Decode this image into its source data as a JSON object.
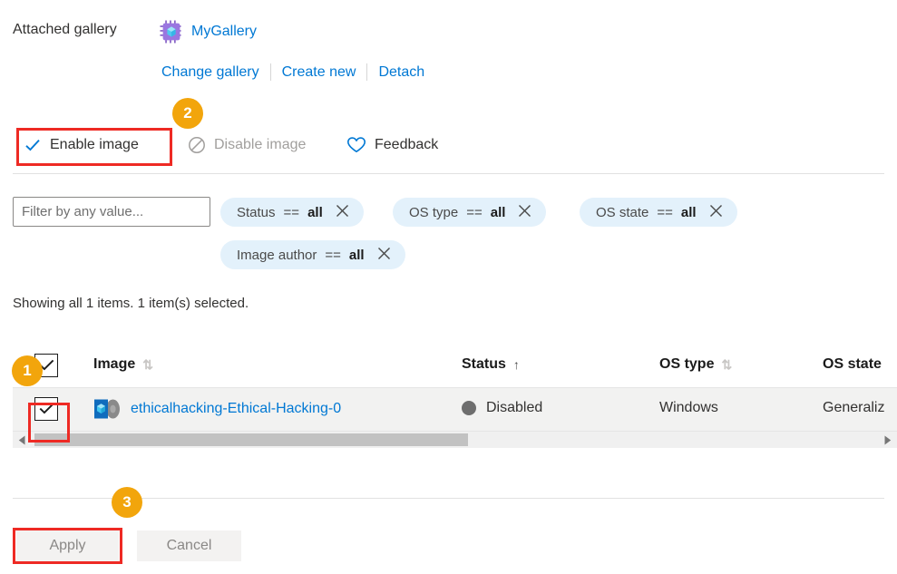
{
  "attached_gallery": {
    "label": "Attached gallery",
    "gallery_name": "MyGallery",
    "gallery_icon": "gallery-chip-icon",
    "actions": [
      {
        "label": "Change gallery"
      },
      {
        "label": "Create new"
      },
      {
        "label": "Detach"
      }
    ]
  },
  "command_bar": {
    "enable": {
      "label": "Enable image",
      "icon": "checkmark-icon",
      "enabled": true
    },
    "disable": {
      "label": "Disable image",
      "icon": "block-circle-icon",
      "enabled": false
    },
    "feedback": {
      "label": "Feedback",
      "icon": "heart-icon",
      "enabled": true
    }
  },
  "filters": {
    "search_placeholder": "Filter by any value...",
    "search_value": "",
    "pills": [
      {
        "field": "Status",
        "op": "==",
        "value": "all",
        "remove_icon": "close-icon"
      },
      {
        "field": "OS type",
        "op": "==",
        "value": "all",
        "remove_icon": "close-icon"
      },
      {
        "field": "OS state",
        "op": "==",
        "value": "all",
        "remove_icon": "close-icon"
      },
      {
        "field": "Image author",
        "op": "==",
        "value": "all",
        "remove_icon": "close-icon"
      }
    ]
  },
  "status_line": "Showing all 1 items.  1 item(s) selected.",
  "table": {
    "select_all_checked": true,
    "columns": [
      {
        "key": "image",
        "label": "Image",
        "sort": "both"
      },
      {
        "key": "status",
        "label": "Status",
        "sort": "asc"
      },
      {
        "key": "ostype",
        "label": "OS type",
        "sort": "both"
      },
      {
        "key": "osstate",
        "label": "OS state",
        "sort": "none"
      }
    ],
    "sort_glyphs": {
      "both": "⇅",
      "asc": "↑"
    },
    "rows": [
      {
        "selected": true,
        "icon": "vm-image-icon",
        "name": "ethicalhacking-Ethical-Hacking-0",
        "status": "Disabled",
        "status_dot_color": "#6e6e6e",
        "ostype": "Windows",
        "osstate": "Generaliz"
      }
    ]
  },
  "scrollbar": {
    "left_arrow_icon": "caret-left-icon",
    "right_arrow_icon": "caret-right-icon"
  },
  "footer": {
    "apply_label": "Apply",
    "cancel_label": "Cancel"
  },
  "annotations": {
    "badges": [
      {
        "id": "1",
        "text": "1"
      },
      {
        "id": "2",
        "text": "2"
      },
      {
        "id": "3",
        "text": "3"
      }
    ],
    "badge_color": "#f2a50c",
    "highlight_color": "#ee2a24"
  }
}
